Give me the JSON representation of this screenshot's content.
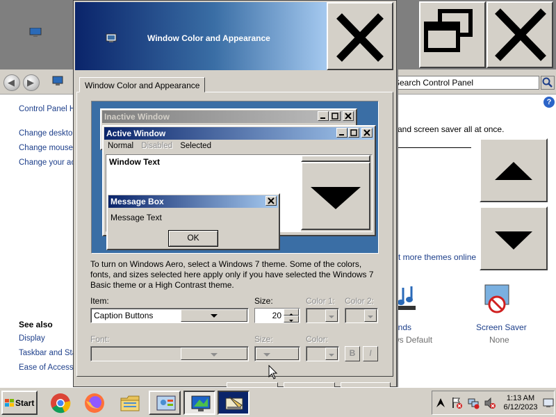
{
  "control_panel": {
    "search_placeholder": "Search Control Panel",
    "left_links": [
      "Control Panel Home",
      "Change desktop icons",
      "Change mouse pointers",
      "Change your account picture"
    ],
    "see_also_title": "See also",
    "see_also_links": [
      "Display",
      "Taskbar and Start Menu",
      "Ease of Access Center"
    ],
    "description": "and screen saver all at once.",
    "more_themes": "t more themes online",
    "sounds_label": "unds",
    "sounds_sub": "ws Default",
    "screen_saver_label": "Screen Saver",
    "screen_saver_sub": "None"
  },
  "dialog": {
    "title": "Window Color and Appearance",
    "tab_label": "Window Color and Appearance",
    "preview": {
      "inactive_title": "Inactive Window",
      "active_title": "Active Window",
      "menu_normal": "Normal",
      "menu_disabled": "Disabled",
      "menu_selected": "Selected",
      "window_text": "Window Text",
      "msgbox_title": "Message Box",
      "msgbox_text": "Message Text",
      "ok_label": "OK"
    },
    "info_text": "To turn on Windows Aero, select a Windows 7 theme.  Some of the colors, fonts, and sizes selected here apply only if you have selected the Windows 7 Basic theme or a High Contrast theme.",
    "item_label": "Item:",
    "item_value": "Caption Buttons",
    "size_label": "Size:",
    "size_value": "20",
    "color1_label": "Color 1:",
    "color2_label": "Color 2:",
    "font_label": "Font:",
    "font_size_label": "Size:",
    "font_color_label": "Color:",
    "bold_label": "B",
    "italic_label": "I"
  },
  "taskbar": {
    "start_label": "Start",
    "time": "1:13 AM",
    "date": "6/12/2023"
  },
  "colors": {
    "title_dark": "#0a246a",
    "title_light": "#a6caf0",
    "desktop_blue": "#3a6ea5",
    "face": "#d4d0c8",
    "link": "#1c3e8a"
  }
}
